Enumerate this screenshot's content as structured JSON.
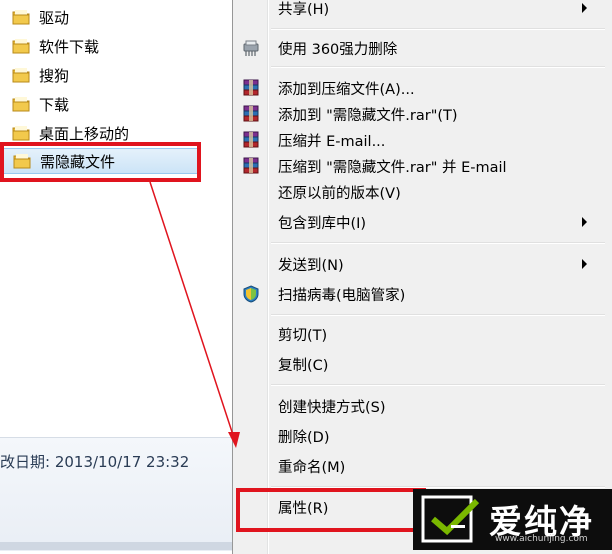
{
  "folders": [
    {
      "name": "驱动"
    },
    {
      "name": "软件下载"
    },
    {
      "name": "搜狗"
    },
    {
      "name": "下载"
    },
    {
      "name": "桌面上移动的"
    },
    {
      "name": "需隐藏文件"
    }
  ],
  "details": {
    "date_text": "改日期: 2013/10/17 23:32"
  },
  "menu": {
    "items": [
      {
        "label": "共享(H)"
      },
      {
        "label": "使用 360强力删除"
      },
      {
        "label": "添加到压缩文件(A)..."
      },
      {
        "label": "添加到 \"需隐藏文件.rar\"(T)"
      },
      {
        "label": "压缩并 E-mail..."
      },
      {
        "label": "压缩到 \"需隐藏文件.rar\" 并 E-mail"
      },
      {
        "label": "还原以前的版本(V)"
      },
      {
        "label": "包含到库中(I)"
      },
      {
        "label": "发送到(N)"
      },
      {
        "label": "扫描病毒(电脑管家)"
      },
      {
        "label": "剪切(T)"
      },
      {
        "label": "复制(C)"
      },
      {
        "label": "创建快捷方式(S)"
      },
      {
        "label": "删除(D)"
      },
      {
        "label": "重命名(M)"
      },
      {
        "label": "属性(R)"
      }
    ]
  },
  "watermark": {
    "brand": "爱纯净",
    "url": "www.aichunjing.com"
  },
  "colors": {
    "annotation_red": "#e0141e",
    "folder_yellow": "#e8b939",
    "selection_blue": "#cce4f7"
  }
}
